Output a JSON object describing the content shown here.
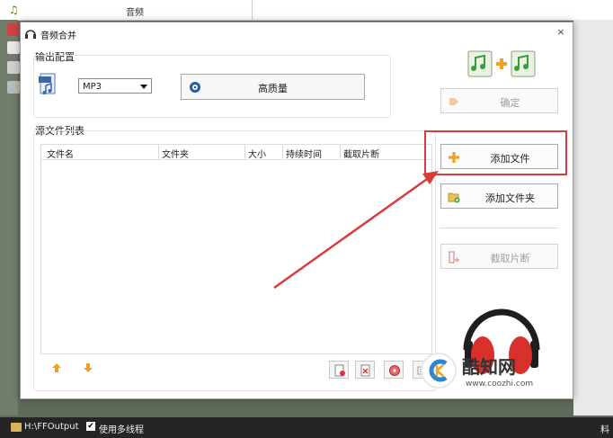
{
  "background_app": {
    "top_title": "音频"
  },
  "dialog": {
    "title": "音频合并",
    "close_glyph": "×",
    "output_section": {
      "label": "输出配置",
      "format_value": "MP3",
      "quality_label": "高质量"
    },
    "source_section": {
      "label": "源文件列表",
      "columns": [
        "文件名",
        "文件夹",
        "大小",
        "持续时间",
        "截取片断"
      ]
    },
    "side_buttons": {
      "confirm": "确定",
      "add_file": "添加文件",
      "add_folder": "添加文件夹",
      "clip": "截取片断"
    }
  },
  "status_bar": {
    "output_path": "H:\\FFOutput",
    "multithread_check": "✔",
    "multithread_label": "使用多线程",
    "right_char": "料"
  },
  "watermark": {
    "brand": "酷知网",
    "url": "www.coozhi.com"
  },
  "colors": {
    "highlight": "#d93a3a",
    "accent_orange": "#f0a028",
    "headphone_red": "#d9302c"
  }
}
